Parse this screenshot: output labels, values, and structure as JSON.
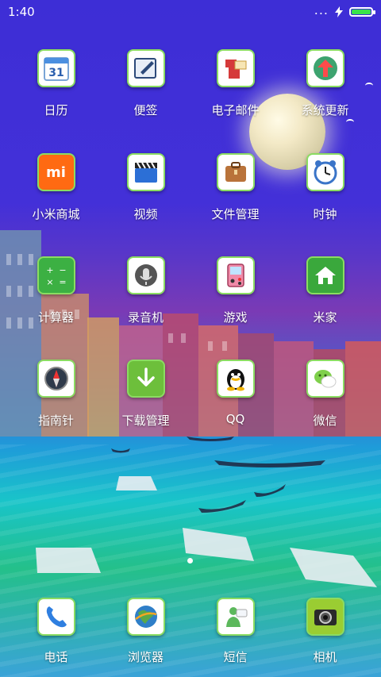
{
  "status_bar": {
    "time": "1:40",
    "more_dots": "...",
    "battery_color": "#3be24a"
  },
  "apps": [
    {
      "label": "日历",
      "icon": "calendar-icon",
      "icon_text": "31"
    },
    {
      "label": "便签",
      "icon": "notes-icon"
    },
    {
      "label": "电子邮件",
      "icon": "email-icon"
    },
    {
      "label": "系统更新",
      "icon": "system-update-icon"
    },
    {
      "label": "小米商城",
      "icon": "mi-store-icon",
      "icon_text": "mi"
    },
    {
      "label": "视频",
      "icon": "video-icon"
    },
    {
      "label": "文件管理",
      "icon": "file-manager-icon"
    },
    {
      "label": "时钟",
      "icon": "clock-icon"
    },
    {
      "label": "计算器",
      "icon": "calculator-icon"
    },
    {
      "label": "录音机",
      "icon": "recorder-icon"
    },
    {
      "label": "游戏",
      "icon": "game-icon"
    },
    {
      "label": "米家",
      "icon": "mijia-home-icon"
    },
    {
      "label": "指南针",
      "icon": "compass-icon"
    },
    {
      "label": "下载管理",
      "icon": "download-icon"
    },
    {
      "label": "QQ",
      "icon": "qq-penguin-icon"
    },
    {
      "label": "微信",
      "icon": "wechat-icon"
    }
  ],
  "dock": [
    {
      "label": "电话",
      "icon": "phone-icon"
    },
    {
      "label": "浏览器",
      "icon": "browser-icon"
    },
    {
      "label": "短信",
      "icon": "sms-icon"
    },
    {
      "label": "相机",
      "icon": "camera-icon"
    }
  ],
  "pager": {
    "current": 1,
    "total": 1
  }
}
